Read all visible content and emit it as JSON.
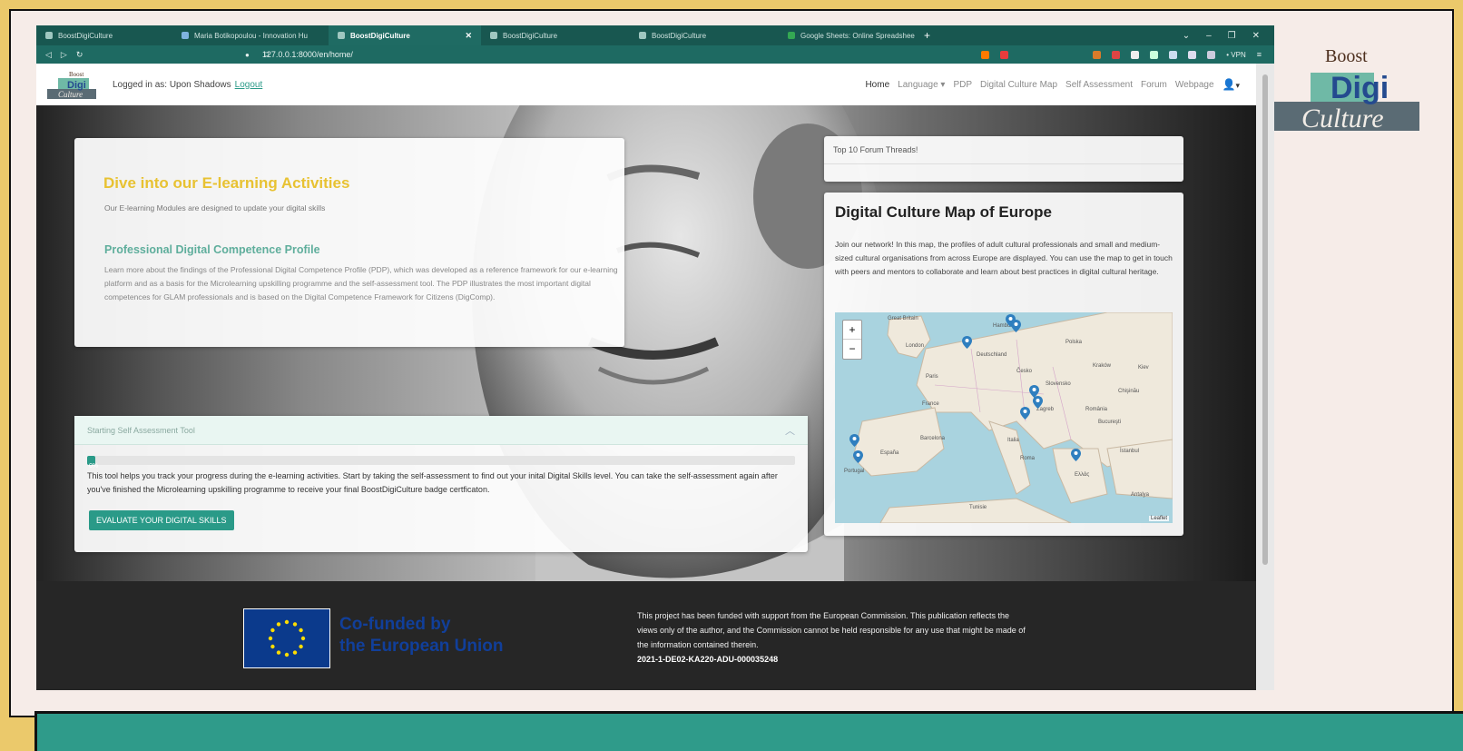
{
  "colors": {
    "brand_teal": "#2a9a88",
    "title_yellow": "#e8c232",
    "frame_gold": "#ebc96b",
    "tab_green": "#185750"
  },
  "browser": {
    "tabs": [
      {
        "label": "BoostDigiCulture",
        "active": false
      },
      {
        "label": "Maria Botikopoulou - Innovation Hu",
        "active": false
      },
      {
        "label": "BoostDigiCulture",
        "active": true
      },
      {
        "label": "BoostDigiCulture",
        "active": false
      },
      {
        "label": "BoostDigiCulture",
        "active": false
      },
      {
        "label": "Google Sheets: Online Spreadsheet E",
        "active": false
      }
    ],
    "new_tab": "+",
    "url": "127.0.0.1:8000/en/home/",
    "vpn_label": "• VPN"
  },
  "navbar": {
    "logged_in_prefix": "Logged in as: Upon Shadows",
    "logout": "Logout",
    "links": [
      "Home",
      "Language ▾",
      "PDP",
      "Digital Culture Map",
      "Self Assessment",
      "Forum",
      "Webpage"
    ],
    "user_caret": "▾"
  },
  "elearning": {
    "title": "Dive into our E-learning Activities",
    "subtitle": "Our E-learning Modules are designed to update your digital skills",
    "pdp_title": "Professional Digital Competence Profile",
    "pdp_body": "Learn more about the findings of the Professional Digital Competence Profile (PDP), which was developed as a reference framework for our e-learning platform and as a basis for the Microlearning upskilling programme and the self-assessment tool. The PDP illustrates the most important digital competences for GLAM professionals and is based on the Digital Competence Framework for Citizens (DigComp)."
  },
  "self_assessment": {
    "header": "Starting Self Assessment Tool",
    "progress_percent": 0,
    "progress_label": "0%",
    "text": "This tool helps you track your progress during the e-learning activities. Start by taking the self-assessment to find out your inital Digital Skills level. You can take the self-assessment again after you've finished the Microlearning upskilling programme to receive your final BoostDigiCulture badge certficaton.",
    "button": "EVALUATE YOUR DIGITAL SKILLS"
  },
  "forum": {
    "title": "Top 10 Forum Threads!"
  },
  "map_card": {
    "title": "Digital Culture Map of Europe",
    "description": "Join our network! In this map, the profiles of adult cultural professionals and small and medium-sized cultural organisations from across Europe are displayed. You can use the map to get in touch with peers and mentors to collaborate and learn about best practices in digital cultural heritage.",
    "zoom_in": "+",
    "zoom_out": "−",
    "attribution": "Leaflet",
    "labels": [
      "Great Britain",
      "London",
      "Hamburg",
      "Polska",
      "Deutschland",
      "Paris",
      "France",
      "Česko",
      "Kraków",
      "Slovensko",
      "Zagreb",
      "România",
      "Bucureşti",
      "Italia",
      "Roma",
      "España",
      "Barcelona",
      "Portugal",
      "Ελλάς",
      "İstanbul",
      "Tunisie",
      "Antalya",
      "Kiev",
      "Chişinău"
    ]
  },
  "footer": {
    "eu_line1": "Co-funded by",
    "eu_line2": "the European Union",
    "disclaimer": "This project has been funded with support from the European Commission. This publication reflects the views only of the author, and the Commission cannot be held responsible for any use that might be made of the information contained therein.",
    "project_code": "2021-1-DE02-KA220-ADU-000035248"
  },
  "corner_logo": {
    "line1": "Boost",
    "line2": "Digi",
    "line3": "Culture"
  },
  "nav_logo": {
    "line1": "Boost",
    "line2": "Digi",
    "line3": "Culture"
  }
}
